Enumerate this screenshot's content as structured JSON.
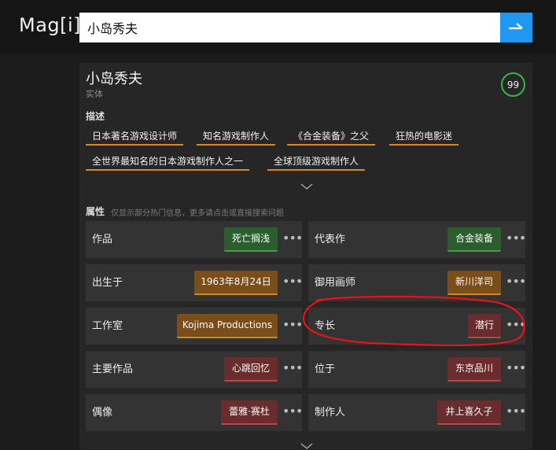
{
  "header": {
    "logo": "Mag[i]",
    "search_value": "小岛秀夫"
  },
  "entity": {
    "title": "小岛秀夫",
    "type": "实体",
    "score": "99"
  },
  "description": {
    "label": "描述",
    "tags": [
      "日本著名游戏设计师",
      "知名游戏制作人",
      "《合金装备》之父",
      "狂热的电影迷",
      "全世界最知名的日本游戏制作人之一",
      "全球顶级游戏制作人"
    ]
  },
  "attributes": {
    "label": "属性",
    "hint": "仅显示部分热门信息，更多请点击或直接搜索问题",
    "rows": [
      {
        "left": {
          "key": "作品",
          "value": "死亡搁浅"
        },
        "right": {
          "key": "代表作",
          "value": "合金装备"
        }
      },
      {
        "left": {
          "key": "出生于",
          "value": "1963年8月24日"
        },
        "right": {
          "key": "御用画师",
          "value": "新川洋司"
        }
      },
      {
        "left": {
          "key": "工作室",
          "value": "Kojima Productions"
        },
        "right": {
          "key": "专长",
          "value": "潜行"
        }
      },
      {
        "left": {
          "key": "主要作品",
          "value": "心跳回忆"
        },
        "right": {
          "key": "位于",
          "value": "东京品川"
        }
      },
      {
        "left": {
          "key": "偶像",
          "value": "蕾雅·赛杜"
        },
        "right": {
          "key": "制作人",
          "value": "井上喜久子"
        }
      }
    ],
    "more_glyph": "•••"
  },
  "colors": {
    "accent_blue": "#1e98f0",
    "score_ring": "#38b34a",
    "tag_underline": "#d88a1f",
    "annotation_red": "#e8121a"
  }
}
